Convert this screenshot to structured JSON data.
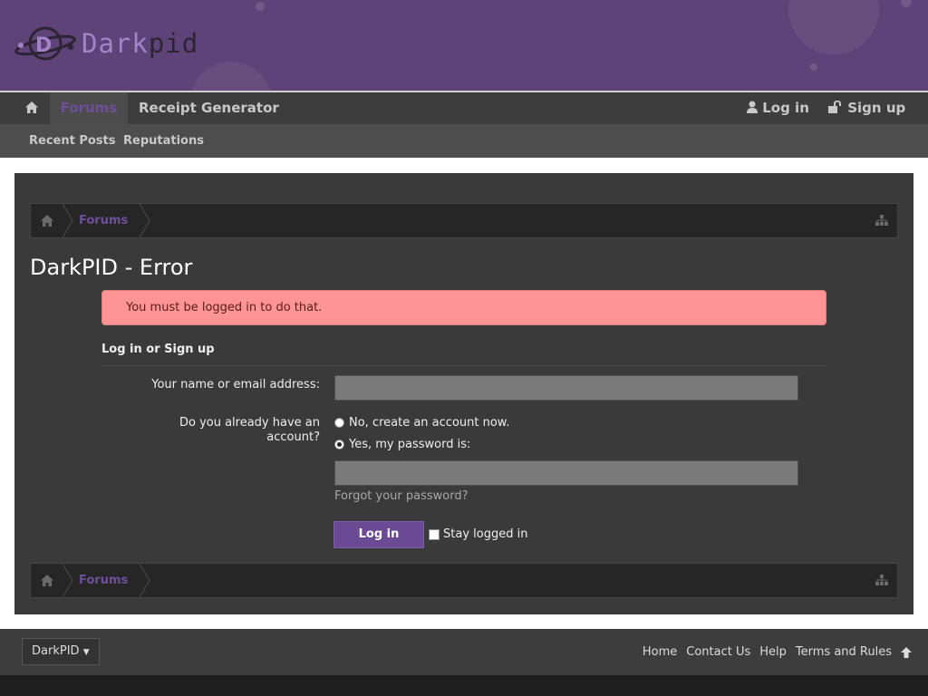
{
  "header": {
    "logo_text_light": "Dark",
    "logo_text_dark": "pid",
    "colors": {
      "header_bg": "#5e4378",
      "accent": "#6f4f9a"
    }
  },
  "nav": {
    "home_icon": "home-icon",
    "tabs": [
      {
        "label": "Forums",
        "active": true
      },
      {
        "label": "Receipt Generator",
        "active": false
      }
    ],
    "login_label": "Log in",
    "signup_label": "Sign up",
    "subnav": [
      "Recent Posts",
      "Reputations"
    ]
  },
  "breadcrumb": {
    "items": [
      "Forums"
    ]
  },
  "page": {
    "title": "DarkPID - Error",
    "error_message": "You must be logged in to do that.",
    "form_heading": "Log in or Sign up",
    "name_label": "Your name or email address:",
    "name_value": "",
    "account_label_line1": "Do you already have an",
    "account_label_line2": "account?",
    "radio_no_label": "No, create an account now.",
    "radio_yes_label": "Yes, my password is:",
    "radio_selected": "yes",
    "password_value": "",
    "forgot_label": "Forgot your password?",
    "login_button": "Log in",
    "stay_logged_in": "Stay logged in"
  },
  "footer": {
    "style_chooser": "DarkPID",
    "links": [
      "Home",
      "Contact Us",
      "Help",
      "Terms and Rules"
    ]
  }
}
